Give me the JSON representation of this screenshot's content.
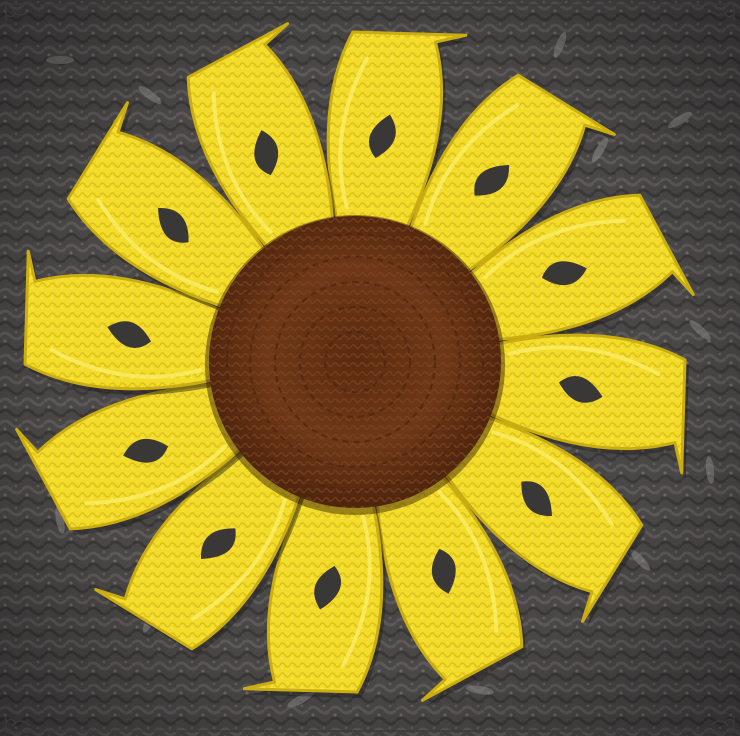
{
  "photo": {
    "subject": "crochet-sunflower",
    "petal_count": 12,
    "colors": {
      "background_yarn": "#4a4747",
      "background_yarn_light": "#6b6767",
      "petal_yellow": "#f3dc2a",
      "petal_shadow": "#c9ad12",
      "petal_highlight": "#fbee6a",
      "center_brown": "#6b3516",
      "center_dark": "#4a220c",
      "frame_line": "#3a3a3a",
      "frame_bg": "#ffffff"
    }
  }
}
